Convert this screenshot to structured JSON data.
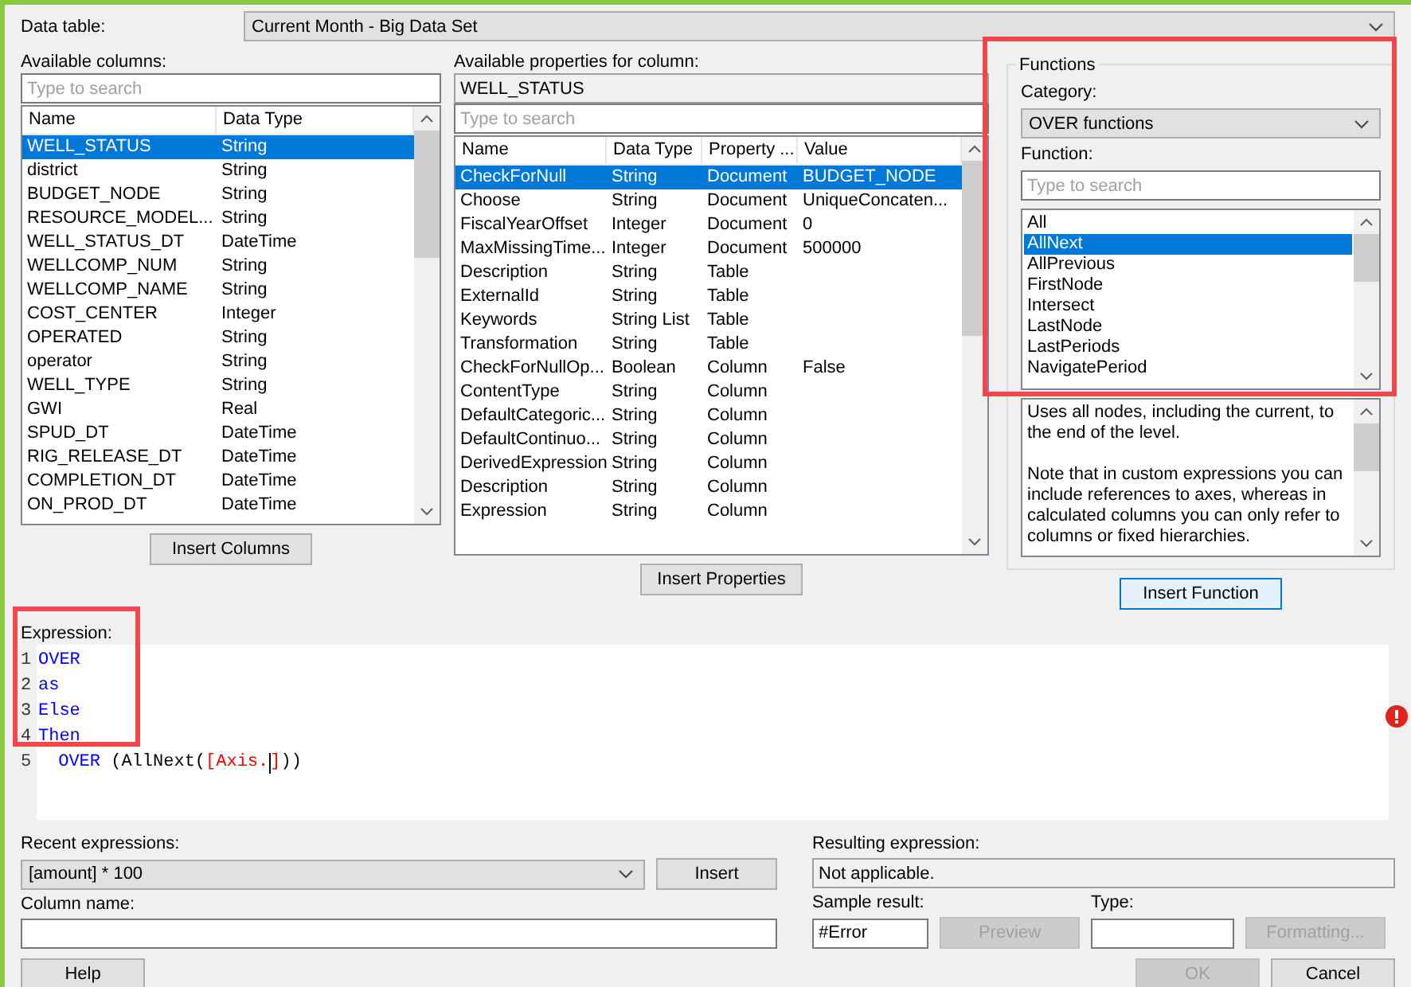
{
  "data_table": {
    "label": "Data table:",
    "value": "Current Month  - Big Data Set"
  },
  "columns_panel": {
    "label": "Available columns:",
    "search": {
      "placeholder": "Type to search"
    },
    "headers": [
      "Name",
      "Data Type"
    ],
    "rows": [
      {
        "cells": [
          "WELL_STATUS",
          "String"
        ],
        "selected": true
      },
      {
        "cells": [
          "district",
          "String"
        ],
        "selected": false
      },
      {
        "cells": [
          "BUDGET_NODE",
          "String"
        ],
        "selected": false
      },
      {
        "cells": [
          "RESOURCE_MODEL...",
          "String"
        ],
        "selected": false
      },
      {
        "cells": [
          "WELL_STATUS_DT",
          "DateTime"
        ],
        "selected": false
      },
      {
        "cells": [
          "WELLCOMP_NUM",
          "String"
        ],
        "selected": false
      },
      {
        "cells": [
          "WELLCOMP_NAME",
          "String"
        ],
        "selected": false
      },
      {
        "cells": [
          "COST_CENTER",
          "Integer"
        ],
        "selected": false
      },
      {
        "cells": [
          "OPERATED",
          "String"
        ],
        "selected": false
      },
      {
        "cells": [
          "operator",
          "String"
        ],
        "selected": false
      },
      {
        "cells": [
          "WELL_TYPE",
          "String"
        ],
        "selected": false
      },
      {
        "cells": [
          "GWI",
          "Real"
        ],
        "selected": false
      },
      {
        "cells": [
          "SPUD_DT",
          "DateTime"
        ],
        "selected": false
      },
      {
        "cells": [
          "RIG_RELEASE_DT",
          "DateTime"
        ],
        "selected": false
      },
      {
        "cells": [
          "COMPLETION_DT",
          "DateTime"
        ],
        "selected": false
      },
      {
        "cells": [
          "ON_PROD_DT",
          "DateTime"
        ],
        "selected": false
      }
    ],
    "button": "Insert Columns"
  },
  "properties_panel": {
    "label": "Available properties for column:",
    "column": "WELL_STATUS",
    "search": {
      "placeholder": "Type to search"
    },
    "headers": [
      "Name",
      "Data Type",
      "Property ...",
      "Value"
    ],
    "rows": [
      {
        "cells": [
          "CheckForNull",
          "String",
          "Document",
          "BUDGET_NODE"
        ],
        "selected": true
      },
      {
        "cells": [
          "Choose",
          "String",
          "Document",
          "UniqueConcaten..."
        ],
        "selected": false
      },
      {
        "cells": [
          "FiscalYearOffset",
          "Integer",
          "Document",
          "0"
        ],
        "selected": false
      },
      {
        "cells": [
          "MaxMissingTime...",
          "Integer",
          "Document",
          "500000"
        ],
        "selected": false
      },
      {
        "cells": [
          "Description",
          "String",
          "Table"
        ],
        "selected": false
      },
      {
        "cells": [
          "ExternalId",
          "String",
          "Table"
        ],
        "selected": false
      },
      {
        "cells": [
          "Keywords",
          "String List",
          "Table"
        ],
        "selected": false
      },
      {
        "cells": [
          "Transformation",
          "String",
          "Table"
        ],
        "selected": false
      },
      {
        "cells": [
          "CheckForNullOp...",
          "Boolean",
          "Column",
          "False"
        ],
        "selected": false
      },
      {
        "cells": [
          "ContentType",
          "String",
          "Column"
        ],
        "selected": false
      },
      {
        "cells": [
          "DefaultCategoric...",
          "String",
          "Column"
        ],
        "selected": false
      },
      {
        "cells": [
          "DefaultContinuo...",
          "String",
          "Column"
        ],
        "selected": false
      },
      {
        "cells": [
          "DerivedExpression",
          "String",
          "Column"
        ],
        "selected": false
      },
      {
        "cells": [
          "Description",
          "String",
          "Column"
        ],
        "selected": false
      },
      {
        "cells": [
          "Expression",
          "String",
          "Column"
        ],
        "selected": false
      }
    ],
    "button": "Insert Properties"
  },
  "functions_panel": {
    "title": "Functions",
    "category_label": "Category:",
    "category": "OVER functions",
    "function_label": "Function:",
    "search": {
      "placeholder": "Type to search"
    },
    "functions": [
      {
        "name": "All",
        "selected": false
      },
      {
        "name": "AllNext",
        "selected": true
      },
      {
        "name": "AllPrevious",
        "selected": false
      },
      {
        "name": "FirstNode",
        "selected": false
      },
      {
        "name": "Intersect",
        "selected": false
      },
      {
        "name": "LastNode",
        "selected": false
      },
      {
        "name": "LastPeriods",
        "selected": false
      },
      {
        "name": "NavigatePeriod",
        "selected": false
      }
    ],
    "description": [
      "Uses all nodes, including the current, to the end of the level.",
      "Note that in custom expressions you can include references to axes, whereas in calculated columns you can only refer to columns or fixed hierarchies."
    ],
    "button": {
      "label": "Insert Function",
      "focused": true
    }
  },
  "expression": {
    "label": "Expression:",
    "lines": [
      {
        "number": "1",
        "tokens": [
          {
            "text": "OVER",
            "kind": "keyword"
          }
        ]
      },
      {
        "number": "2",
        "tokens": [
          {
            "text": "as",
            "kind": "keyword"
          }
        ]
      },
      {
        "number": "3",
        "tokens": [
          {
            "text": "Else",
            "kind": "keyword"
          }
        ]
      },
      {
        "number": "4",
        "tokens": [
          {
            "text": "Then",
            "kind": "keyword"
          }
        ]
      },
      {
        "number": "5",
        "tokens": [
          {
            "text": " OVER",
            "kind": "keyword"
          },
          {
            "text": " (AllNext(",
            "kind": "plain"
          },
          {
            "text": "[Axis.",
            "kind": "column"
          },
          {
            "kind": "caret"
          },
          {
            "text": "]",
            "kind": "column"
          },
          {
            "text": "))",
            "kind": "plain"
          }
        ]
      }
    ],
    "error": true
  },
  "recent": {
    "label": "Recent expressions:",
    "value": "[amount] * 100",
    "button": "Insert"
  },
  "column_name": {
    "label": "Column name:"
  },
  "resulting": {
    "label": "Resulting expression:",
    "value": "Not applicable."
  },
  "sample": {
    "label": "Sample result:",
    "value": "#Error"
  },
  "preview_button": {
    "label": "Preview",
    "disabled": true
  },
  "type": {
    "label": "Type:"
  },
  "formatting_button": {
    "label": "Formatting...",
    "disabled": true
  },
  "footer_buttons": [
    {
      "label": "Help",
      "disabled": false
    },
    {
      "label": "OK",
      "disabled": true
    },
    {
      "label": "Cancel",
      "disabled": false
    }
  ]
}
